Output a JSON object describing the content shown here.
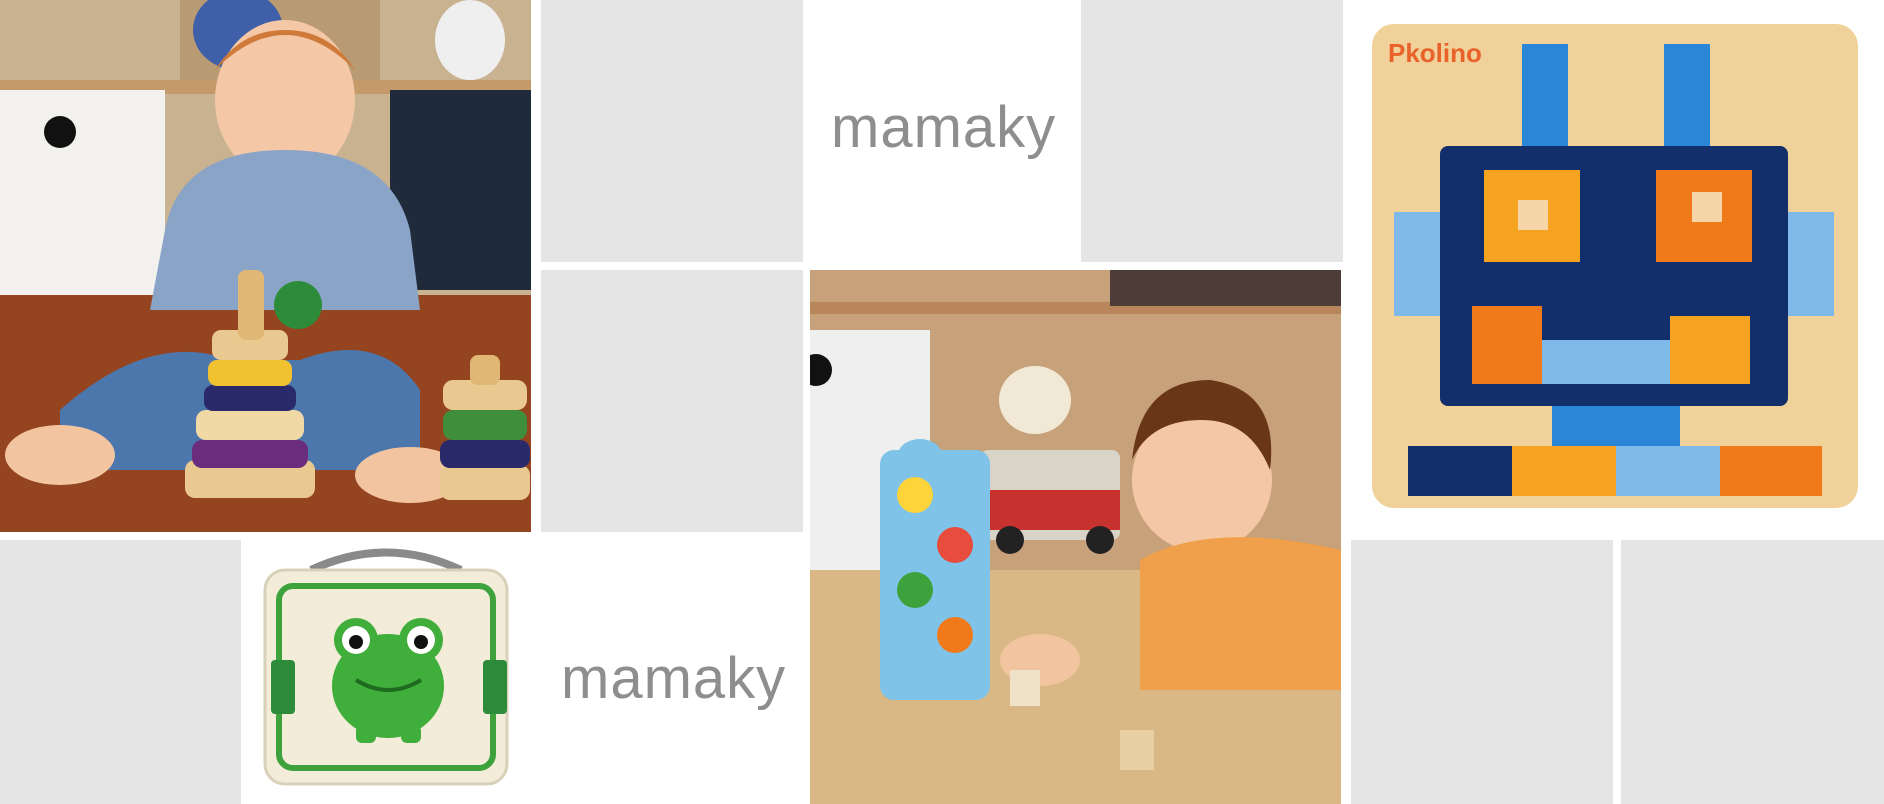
{
  "brand": {
    "mamaky_logo_text": "mamaky",
    "pkolino_logo_text": "Pkolino"
  },
  "colors": {
    "gray_tile": "#e5e5e5",
    "logo_gray": "#8e8e8e",
    "pkolino_orange": "#e8622a"
  },
  "icons": {
    "frog": "frog-illustration",
    "robot": "robot-puzzle"
  }
}
